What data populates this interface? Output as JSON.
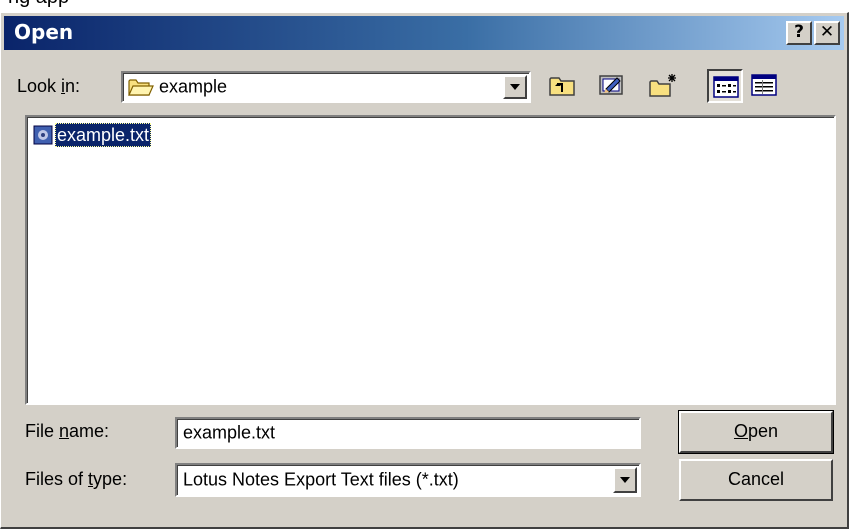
{
  "page_caption": "ng app",
  "dialog": {
    "title": "Open",
    "help_label": "?",
    "close_label": "✕"
  },
  "look_in": {
    "label_prefix": "Look ",
    "label_mnemonic": "i",
    "label_suffix": "n:",
    "value": "example",
    "folder_icon": "folder-open-icon"
  },
  "toolbar": {
    "buttons": [
      {
        "name": "up-one-level",
        "icon": "folder-up-icon"
      },
      {
        "name": "desktop",
        "icon": "desktop-icon"
      },
      {
        "name": "create-new-folder",
        "icon": "new-folder-icon"
      },
      {
        "name": "list-view",
        "icon": "list-view-icon",
        "pressed": true
      },
      {
        "name": "details-view",
        "icon": "details-view-icon"
      }
    ]
  },
  "files": [
    {
      "name": "example.txt",
      "icon": "text-file-icon",
      "selected": true
    }
  ],
  "file_name": {
    "label_prefix": "File ",
    "label_mnemonic": "n",
    "label_suffix": "ame:",
    "value": "example.txt"
  },
  "file_type": {
    "label_prefix": "Files of ",
    "label_mnemonic": "t",
    "label_suffix": "ype:",
    "value": "Lotus Notes Export Text files (*.txt)"
  },
  "buttons": {
    "open_mnemonic": "O",
    "open_rest": "pen",
    "cancel": "Cancel"
  },
  "colors": {
    "face": "#d4d0c8",
    "title_start": "#0a246a",
    "title_end": "#a6caf0",
    "selection": "#0a246a"
  }
}
